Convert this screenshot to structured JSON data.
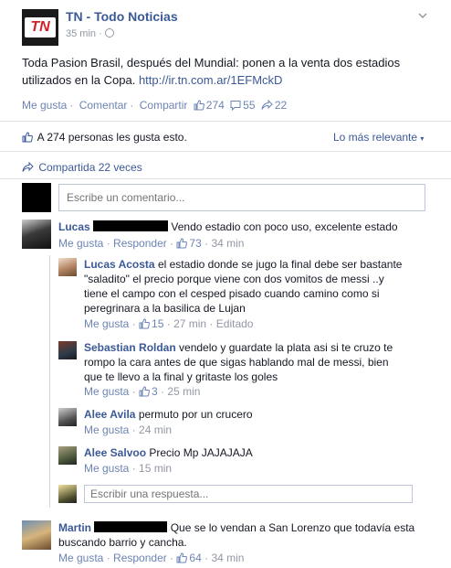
{
  "post": {
    "page_name": "TN - Todo Noticias",
    "logo_text": "TN",
    "time": "35 min ·",
    "text": "Toda Pasion Brasil, después del Mundial: ponen a la venta dos estadios utilizados en la Copa.",
    "link": "http://ir.tn.com.ar/1EFMckD"
  },
  "actions": {
    "like": "Me gusta",
    "comment": "Comentar",
    "share": "Compartir",
    "like_count": "274",
    "comment_count": "55",
    "share_count": "22"
  },
  "summary": {
    "likes_text": "A 274 personas les gusta esto.",
    "sort_label": "Lo más relevante",
    "shares_text": "Compartida 22 veces"
  },
  "composer": {
    "placeholder": "Escribe un comentario..."
  },
  "comments": [
    {
      "name": "Lucas",
      "text": "Vendo estadio con poco uso, excelente estado",
      "like": "Me gusta",
      "reply": "Responder",
      "likes": "73",
      "time": "34 min"
    },
    {
      "name": "Martin",
      "text": "Que se lo vendan a San Lorenzo que todavía esta buscando barrio y cancha.",
      "like": "Me gusta",
      "reply": "Responder",
      "likes": "64",
      "time": "34 min"
    }
  ],
  "replies": [
    {
      "name": "Lucas Acosta",
      "text": "el estadio donde se jugo la final debe ser bastante \"saladito\" el precio porque viene con dos vomitos de messi ..y tiene el campo con el cesped pisado cuando camino como si peregrinara a la basilica de Lujan",
      "like": "Me gusta",
      "likes": "15",
      "time": "27 min",
      "edited": "Editado"
    },
    {
      "name": "Sebastian Roldan",
      "text": "vendelo y guardate la plata asi si te cruzo te rompo la cara antes de que sigas hablando mal de messi, bien que te llevo a la final y gritaste los goles",
      "like": "Me gusta",
      "likes": "3",
      "time": "25 min"
    },
    {
      "name": "Alee Avila",
      "text": "permuto por un crucero",
      "like": "Me gusta",
      "time": "24 min"
    },
    {
      "name": "Alee Salvoo",
      "text": "Precio Mp JAJAJAJA",
      "like": "Me gusta",
      "time": "15 min"
    }
  ],
  "reply_composer": {
    "placeholder": "Escribir una respuesta..."
  }
}
